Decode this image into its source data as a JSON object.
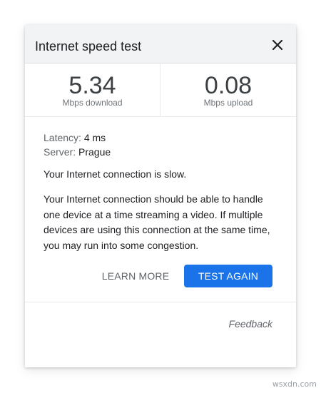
{
  "dialog": {
    "title": "Internet speed test",
    "close_icon": "close-icon"
  },
  "metrics": {
    "download": {
      "value": "5.34",
      "label": "Mbps download"
    },
    "upload": {
      "value": "0.08",
      "label": "Mbps upload"
    }
  },
  "details": {
    "latency_key": "Latency:",
    "latency_value": "4 ms",
    "server_key": "Server:",
    "server_value": "Prague"
  },
  "status": "Your Internet connection is slow.",
  "description": "Your Internet connection should be able to handle one device at a time streaming a video. If multiple devices are using this connection at the same time, you may run into some congestion.",
  "actions": {
    "learn_more": "LEARN MORE",
    "test_again": "TEST AGAIN"
  },
  "feedback": "Feedback",
  "watermark": "wsxdn.com",
  "colors": {
    "accent": "#1a73e8",
    "header_bg": "#f1f3f4"
  }
}
